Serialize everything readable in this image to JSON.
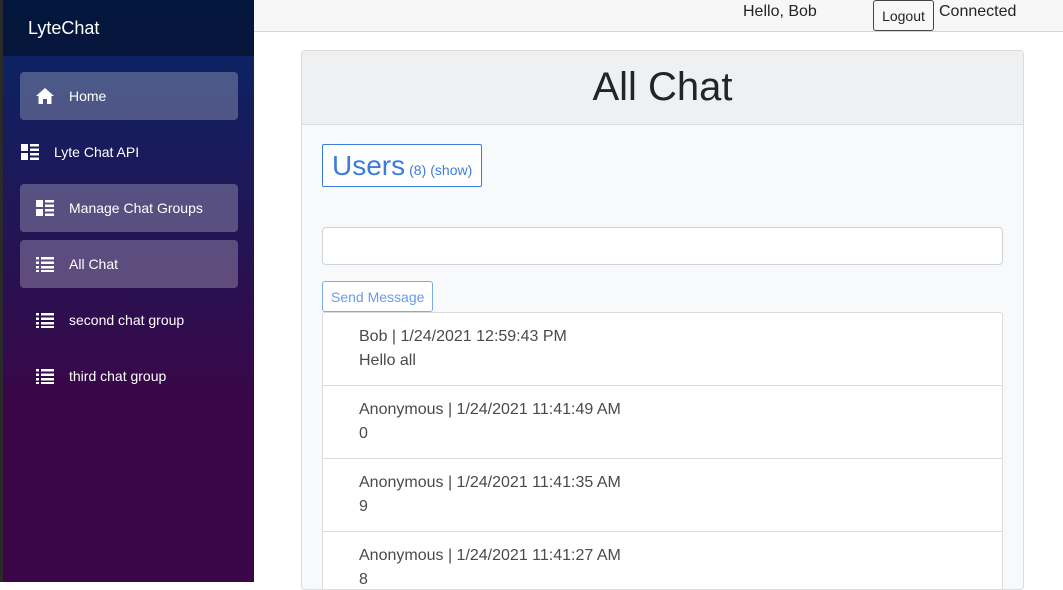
{
  "app": {
    "brand": "LyteChat"
  },
  "sidebar": {
    "items": [
      {
        "label": "Home",
        "icon": "home-icon",
        "active": true
      },
      {
        "label": "Lyte Chat API",
        "icon": "list-grid-icon",
        "active": false
      },
      {
        "label": "Manage Chat Groups",
        "icon": "list-grid-icon",
        "active": true
      },
      {
        "label": "All Chat",
        "icon": "list-icon",
        "active": true
      },
      {
        "label": "second chat group",
        "icon": "list-icon",
        "active": false
      },
      {
        "label": "third chat group",
        "icon": "list-icon",
        "active": false
      }
    ]
  },
  "topbar": {
    "greeting": "Hello, Bob",
    "logout_label": "Logout",
    "status": "Connected"
  },
  "main": {
    "title": "All Chat",
    "users": {
      "label": "Users",
      "count": "(8)",
      "toggle": "(show)"
    },
    "input": {
      "value": "",
      "placeholder": ""
    },
    "send_label": "Send Message",
    "messages": [
      {
        "meta": "Bob | 1/24/2021 12:59:43 PM",
        "text": "Hello all"
      },
      {
        "meta": "Anonymous | 1/24/2021 11:41:49 AM",
        "text": "0"
      },
      {
        "meta": "Anonymous | 1/24/2021 11:41:35 AM",
        "text": "9"
      },
      {
        "meta": "Anonymous | 1/24/2021 11:41:27 AM",
        "text": "8"
      }
    ]
  },
  "colors": {
    "accent": "#3b7ddd",
    "sidebar_top": "#052767",
    "sidebar_bottom": "#3a0647"
  }
}
